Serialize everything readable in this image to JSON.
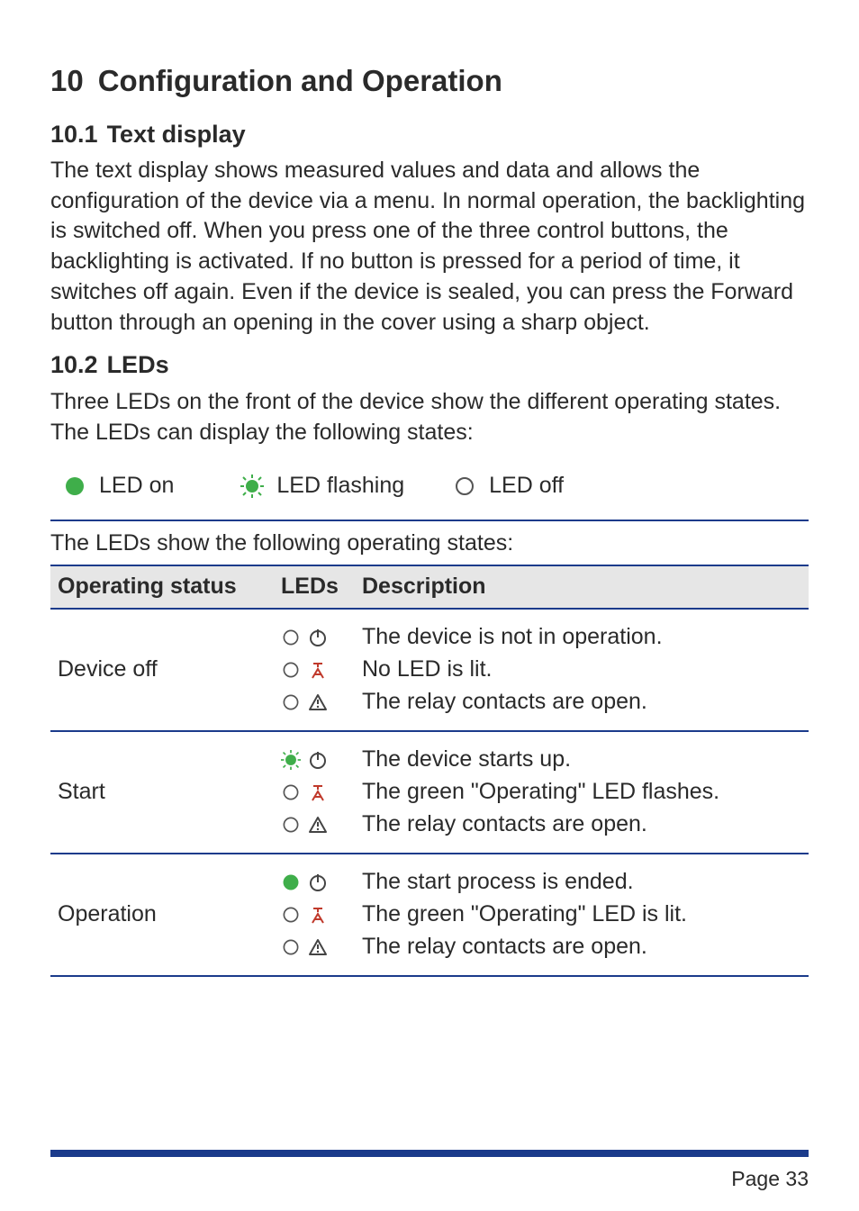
{
  "chapter": {
    "number": "10",
    "title": "Configuration and Operation"
  },
  "section1": {
    "number": "10.1",
    "title": "Text display",
    "body": "The text display shows measured values and data and allows the configuration of the device via a menu. In normal operation, the backlighting is switched off. When you press one of the three control buttons, the backlighting is activated. If no button is pressed for a period of time, it switches off again. Even if the device is sealed, you can press the Forward button through an opening in the cover using a sharp object."
  },
  "section2": {
    "number": "10.2",
    "title": "LEDs",
    "intro": "Three LEDs on the front of the device  show the different operating states. The LEDs can display the following states:",
    "legend": {
      "on": "LED on",
      "flashing": "LED flashing",
      "off": "LED off"
    },
    "states_intro": "The LEDs show the following operating states:",
    "table_headers": {
      "status": "Operating status",
      "leds": "LEDs",
      "desc": "Description"
    },
    "rows": [
      {
        "status": "Device off",
        "leds": [
          "off",
          "off",
          "off"
        ],
        "desc": [
          "The device is not in operation.",
          "No LED is lit.",
          "The relay contacts are open."
        ]
      },
      {
        "status": "Start",
        "leds": [
          "flashing",
          "off",
          "off"
        ],
        "desc": [
          "The device starts up.",
          "The green \"Operating\" LED flashes.",
          "The relay contacts are open."
        ]
      },
      {
        "status": "Operation",
        "leds": [
          "on",
          "off",
          "off"
        ],
        "desc": [
          "The start process is ended.",
          "The green \"Operating\" LED is lit.",
          "The relay contacts are open."
        ]
      }
    ]
  },
  "page_label": "Page 33"
}
